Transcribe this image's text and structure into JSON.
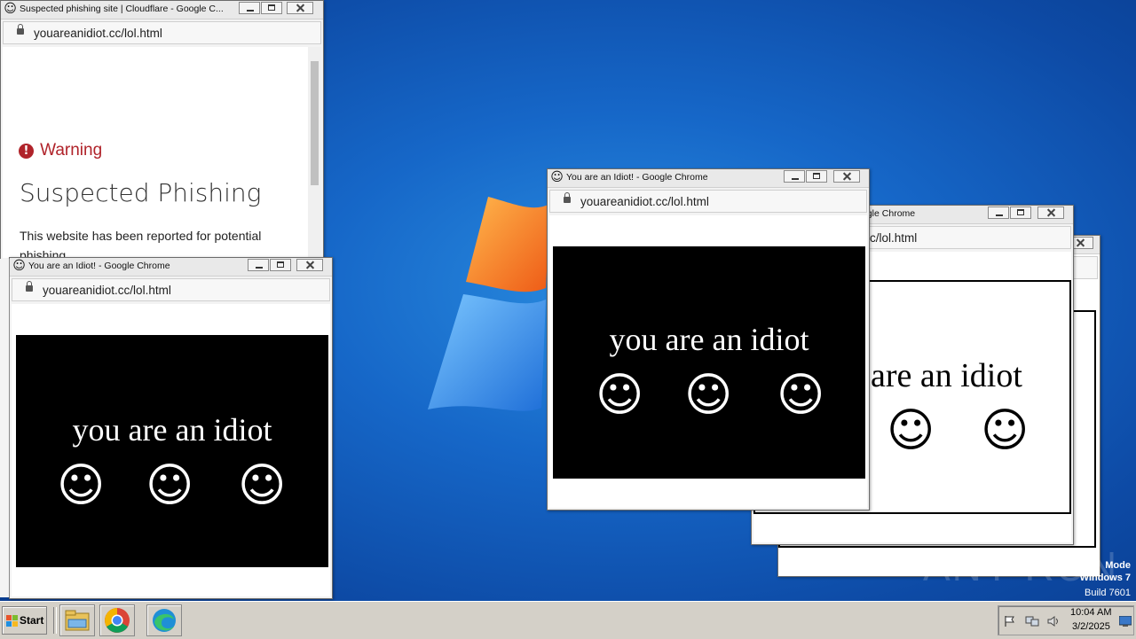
{
  "colors": {
    "warning_red": "#b0232a",
    "idiot_bg": "#000000",
    "desktop": "#1667c8"
  },
  "windows": {
    "phishing": {
      "title": "Suspected phishing site | Cloudflare - Google C...",
      "url": "youareanidiot.cc/lol.html",
      "warning_label": "Warning",
      "heading": "Suspected Phishing",
      "body": "This website has been reported for potential phishing."
    },
    "idiot_left": {
      "title": "You are an Idiot! - Google Chrome",
      "url": "youareanidiot.cc/lol.html",
      "message": "you are an idiot"
    },
    "idiot_center": {
      "title": "You are an Idiot! - Google Chrome",
      "url": "youareanidiot.cc/lol.html",
      "message": "you are an idiot"
    },
    "idiot_back": {
      "title": "ogle Chrome",
      "url": "c/lol.html",
      "message": "are an idiot"
    }
  },
  "smiley_glyph": "☺",
  "watermark": {
    "text": "ANY RUN",
    "mode_line1": "Mode",
    "mode_line2": "Windows 7",
    "build": "Build 7601"
  },
  "taskbar": {
    "start_label": "Start",
    "apps": [
      "explorer-icon",
      "chrome-icon",
      "edge-icon"
    ],
    "clock_time": "10:04 AM",
    "clock_date": "3/2/2025"
  }
}
